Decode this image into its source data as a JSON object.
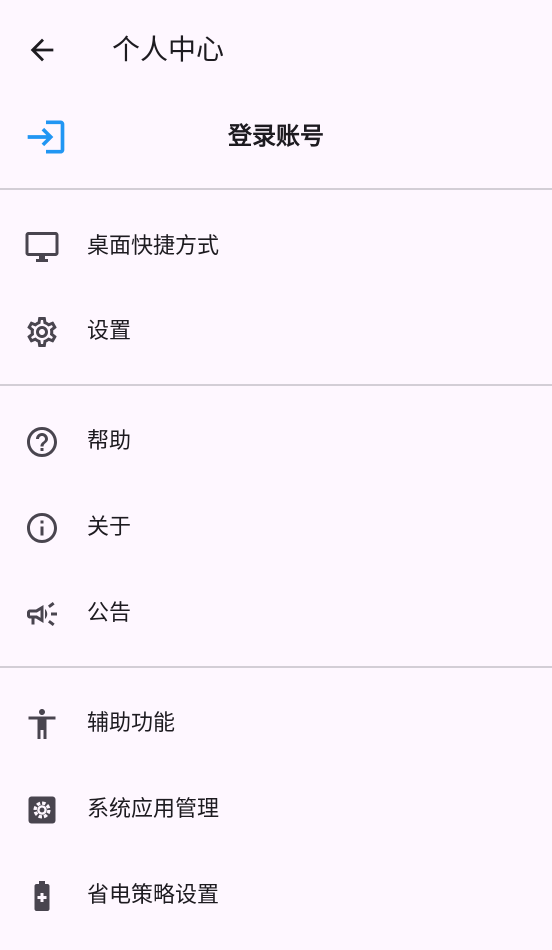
{
  "appbar": {
    "title": "个人中心",
    "back_icon": "arrow-left-icon"
  },
  "login": {
    "label": "登录账号",
    "icon": "login-icon",
    "accent_color": "#2196f3"
  },
  "sections": [
    {
      "items": [
        {
          "label": "桌面快捷方式",
          "icon": "monitor-icon"
        },
        {
          "label": "设置",
          "icon": "gear-icon"
        }
      ]
    },
    {
      "items": [
        {
          "label": "帮助",
          "icon": "help-circle-icon"
        },
        {
          "label": "关于",
          "icon": "info-circle-icon"
        },
        {
          "label": "公告",
          "icon": "megaphone-icon"
        }
      ]
    },
    {
      "items": [
        {
          "label": "辅助功能",
          "icon": "accessibility-icon"
        },
        {
          "label": "系统应用管理",
          "icon": "app-settings-icon"
        },
        {
          "label": "省电策略设置",
          "icon": "battery-plus-icon"
        }
      ]
    }
  ],
  "colors": {
    "background": "#fef7ff",
    "text": "#1d1b20",
    "icon": "#49454f",
    "divider": "#d3ced6"
  }
}
